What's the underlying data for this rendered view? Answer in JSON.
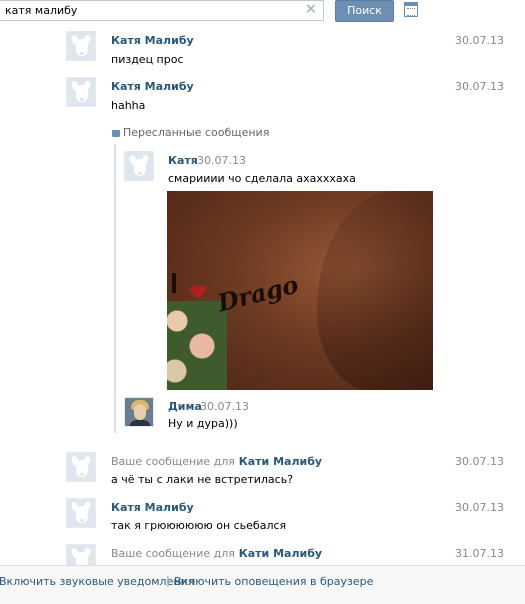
{
  "search": {
    "value": "катя малибу",
    "clear_icon": "×",
    "button_label": "Поиск",
    "calendar_icon": "calendar-icon"
  },
  "messages": [
    {
      "author": "Катя Малибу",
      "date": "30.07.13",
      "text": "пиздец прос"
    },
    {
      "author": "Катя Малибу",
      "date": "30.07.13",
      "text": "hahha"
    },
    {
      "prefix": "Ваше сообщение для",
      "author": "Кати Малибу",
      "date": "30.07.13",
      "text": "а чё ты с лаки не встретилась?"
    },
    {
      "author": "Катя Малибу",
      "date": "30.07.13",
      "text": "так я грюююююю он сьебался"
    },
    {
      "prefix": "Ваше сообщение для",
      "author": "Кати Малибу",
      "date": "31.07.13",
      "text": ""
    }
  ],
  "forwarded": {
    "label": "Пересланные сообщения",
    "items": [
      {
        "author": "Катя",
        "date": "30.07.13",
        "text": "смарииии чо сделала ахахххаха"
      },
      {
        "author": "Дима",
        "date": "30.07.13",
        "text": "Ну и дура)))"
      }
    ],
    "photo_text": "Drago"
  },
  "footer": {
    "sound_link": "Включить звуковые уведомления",
    "separator": "|",
    "browser_link": "Включить оповещения в браузере"
  }
}
